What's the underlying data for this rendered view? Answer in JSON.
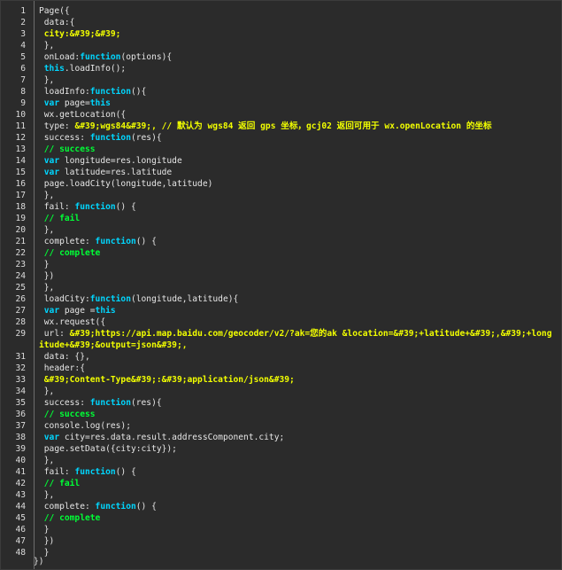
{
  "colors": {
    "background": "#2b2b2b",
    "text": "#e6e6e6",
    "line_number": "#dcdcdc",
    "keyword": "#00d6ff",
    "comment": "#00ff36",
    "string": "#f2ff00",
    "gutter_border": "#6e6e6e"
  },
  "editor": {
    "lines": [
      {
        "n": "1",
        "segs": [
          {
            "t": "Page({",
            "c": ""
          }
        ]
      },
      {
        "n": "2",
        "segs": [
          {
            "t": " data:{",
            "c": ""
          }
        ]
      },
      {
        "n": "3",
        "segs": [
          {
            "t": " city:&#39;&#39;",
            "c": "str"
          }
        ]
      },
      {
        "n": "4",
        "segs": [
          {
            "t": " },",
            "c": ""
          }
        ]
      },
      {
        "n": "5",
        "segs": [
          {
            "t": " onLoad:",
            "c": ""
          },
          {
            "t": "function",
            "c": "kw"
          },
          {
            "t": "(options){",
            "c": ""
          }
        ]
      },
      {
        "n": "6",
        "segs": [
          {
            "t": " ",
            "c": ""
          },
          {
            "t": "this",
            "c": "kw"
          },
          {
            "t": ".loadInfo();",
            "c": ""
          }
        ]
      },
      {
        "n": "7",
        "segs": [
          {
            "t": " },",
            "c": ""
          }
        ]
      },
      {
        "n": "8",
        "segs": [
          {
            "t": " loadInfo:",
            "c": ""
          },
          {
            "t": "function",
            "c": "kw"
          },
          {
            "t": "(){",
            "c": ""
          }
        ]
      },
      {
        "n": "9",
        "segs": [
          {
            "t": " ",
            "c": ""
          },
          {
            "t": "var",
            "c": "kw"
          },
          {
            "t": " page=",
            "c": ""
          },
          {
            "t": "this",
            "c": "kw"
          }
        ]
      },
      {
        "n": "10",
        "segs": [
          {
            "t": " wx.getLocation({",
            "c": ""
          }
        ]
      },
      {
        "n": "11",
        "segs": [
          {
            "t": " type: ",
            "c": ""
          },
          {
            "t": "&#39;wgs84&#39;,",
            "c": "str"
          },
          {
            "t": " // 默认为 wgs84 返回 gps 坐标，gcj02 返回可用于 wx.openLocation 的坐标",
            "c": "str"
          }
        ]
      },
      {
        "n": "12",
        "segs": [
          {
            "t": " success: ",
            "c": ""
          },
          {
            "t": "function",
            "c": "kw"
          },
          {
            "t": "(res){",
            "c": ""
          }
        ]
      },
      {
        "n": "13",
        "segs": [
          {
            "t": " // success",
            "c": "cm"
          }
        ]
      },
      {
        "n": "14",
        "segs": [
          {
            "t": " ",
            "c": ""
          },
          {
            "t": "var",
            "c": "kw"
          },
          {
            "t": " longitude=res.longitude",
            "c": ""
          }
        ]
      },
      {
        "n": "15",
        "segs": [
          {
            "t": " ",
            "c": ""
          },
          {
            "t": "var",
            "c": "kw"
          },
          {
            "t": " latitude=res.latitude",
            "c": ""
          }
        ]
      },
      {
        "n": "16",
        "segs": [
          {
            "t": " page.loadCity(longitude,latitude)",
            "c": ""
          }
        ]
      },
      {
        "n": "17",
        "segs": [
          {
            "t": " },",
            "c": ""
          }
        ]
      },
      {
        "n": "18",
        "segs": [
          {
            "t": " fail: ",
            "c": ""
          },
          {
            "t": "function",
            "c": "kw"
          },
          {
            "t": "() {",
            "c": ""
          }
        ]
      },
      {
        "n": "19",
        "segs": [
          {
            "t": " // fail",
            "c": "cm"
          }
        ]
      },
      {
        "n": "20",
        "segs": [
          {
            "t": " },",
            "c": ""
          }
        ]
      },
      {
        "n": "21",
        "segs": [
          {
            "t": " complete: ",
            "c": ""
          },
          {
            "t": "function",
            "c": "kw"
          },
          {
            "t": "() {",
            "c": ""
          }
        ]
      },
      {
        "n": "22",
        "segs": [
          {
            "t": " // complete",
            "c": "cm"
          }
        ]
      },
      {
        "n": "23",
        "segs": [
          {
            "t": " }",
            "c": ""
          }
        ]
      },
      {
        "n": "24",
        "segs": [
          {
            "t": " })",
            "c": ""
          }
        ]
      },
      {
        "n": "25",
        "segs": [
          {
            "t": " },",
            "c": ""
          }
        ]
      },
      {
        "n": "26",
        "segs": [
          {
            "t": " loadCity:",
            "c": ""
          },
          {
            "t": "function",
            "c": "kw"
          },
          {
            "t": "(longitude,latitude){",
            "c": ""
          }
        ]
      },
      {
        "n": "27",
        "segs": [
          {
            "t": " ",
            "c": ""
          },
          {
            "t": "var",
            "c": "kw"
          },
          {
            "t": " page =",
            "c": ""
          },
          {
            "t": "this",
            "c": "kw"
          }
        ]
      },
      {
        "n": "28",
        "segs": [
          {
            "t": " wx.request({",
            "c": ""
          }
        ]
      },
      {
        "n": "29",
        "wrap": true,
        "segs": [
          {
            "t": " url: ",
            "c": ""
          },
          {
            "t": "&#39;https://api.map.baidu.com/geocoder/v2/?ak=您的ak &location=&#39;+latitude+&#39;,&#39;+longitude+&#39;&output=json&#39;,",
            "c": "str"
          }
        ]
      },
      {
        "n": "31",
        "segs": [
          {
            "t": " data: {},",
            "c": ""
          }
        ]
      },
      {
        "n": "32",
        "segs": [
          {
            "t": " header:{",
            "c": ""
          }
        ]
      },
      {
        "n": "33",
        "segs": [
          {
            "t": " &#39;Content-Type&#39;:&#39;application/json&#39;",
            "c": "str"
          }
        ]
      },
      {
        "n": "34",
        "segs": [
          {
            "t": " },",
            "c": ""
          }
        ]
      },
      {
        "n": "35",
        "segs": [
          {
            "t": " success: ",
            "c": ""
          },
          {
            "t": "function",
            "c": "kw"
          },
          {
            "t": "(res){",
            "c": ""
          }
        ]
      },
      {
        "n": "36",
        "segs": [
          {
            "t": " // success",
            "c": "cm"
          }
        ]
      },
      {
        "n": "37",
        "segs": [
          {
            "t": " console.log(res);",
            "c": ""
          }
        ]
      },
      {
        "n": "38",
        "segs": [
          {
            "t": " ",
            "c": ""
          },
          {
            "t": "var",
            "c": "kw"
          },
          {
            "t": " city=res.data.result.addressComponent.city;",
            "c": ""
          }
        ]
      },
      {
        "n": "39",
        "segs": [
          {
            "t": " page.setData({city:city});",
            "c": ""
          }
        ]
      },
      {
        "n": "40",
        "segs": [
          {
            "t": " },",
            "c": ""
          }
        ]
      },
      {
        "n": "41",
        "segs": [
          {
            "t": " fail: ",
            "c": ""
          },
          {
            "t": "function",
            "c": "kw"
          },
          {
            "t": "() {",
            "c": ""
          }
        ]
      },
      {
        "n": "42",
        "segs": [
          {
            "t": " // fail",
            "c": "cm"
          }
        ]
      },
      {
        "n": "43",
        "segs": [
          {
            "t": " },",
            "c": ""
          }
        ]
      },
      {
        "n": "44",
        "segs": [
          {
            "t": " complete: ",
            "c": ""
          },
          {
            "t": "function",
            "c": "kw"
          },
          {
            "t": "() {",
            "c": ""
          }
        ]
      },
      {
        "n": "45",
        "segs": [
          {
            "t": " // complete",
            "c": "cm"
          }
        ]
      },
      {
        "n": "46",
        "segs": [
          {
            "t": " }",
            "c": ""
          }
        ]
      },
      {
        "n": "47",
        "segs": [
          {
            "t": " })",
            "c": ""
          }
        ]
      },
      {
        "n": "48",
        "segs": [
          {
            "t": " }",
            "c": ""
          }
        ]
      }
    ],
    "closing_line": "})"
  }
}
